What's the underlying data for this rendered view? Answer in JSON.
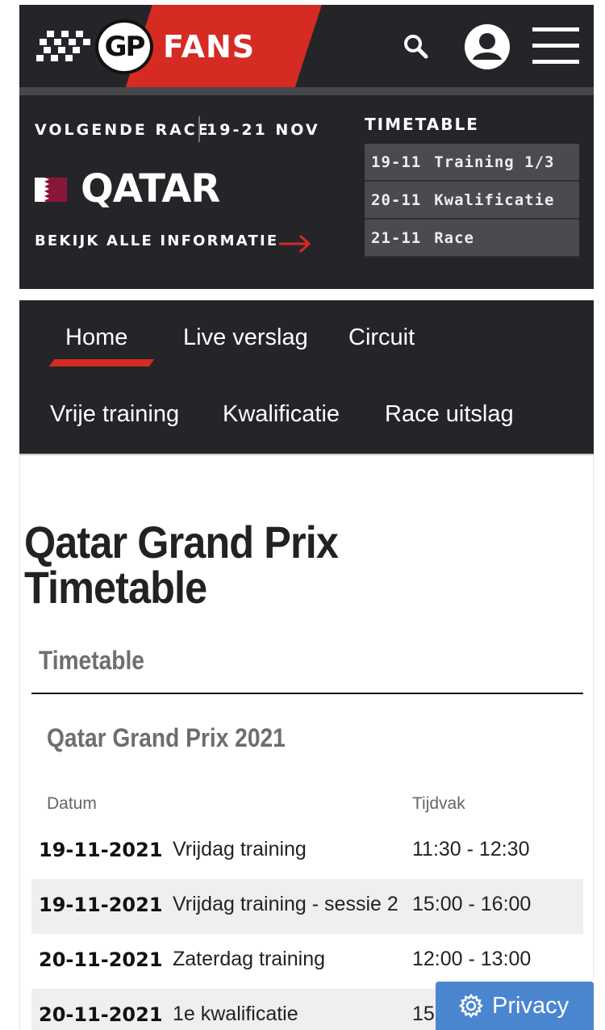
{
  "brand": {
    "logo_gp": "GP",
    "logo_fans": "FANS",
    "brand_red": "#d52b23"
  },
  "header": {
    "icons": [
      "search-icon",
      "user-icon",
      "menu-icon"
    ]
  },
  "next_race": {
    "label": "VOLGENDE RACE",
    "dates": "19-21 NOV",
    "country": "QATAR",
    "info_link": "BEKIJK ALLE INFORMATIE",
    "timetable_title": "TIMETABLE",
    "timetable": [
      {
        "date": "19-11",
        "session": "Training 1/3"
      },
      {
        "date": "20-11",
        "session": "Kwalificatie"
      },
      {
        "date": "21-11",
        "session": "Race"
      }
    ]
  },
  "nav": {
    "items": [
      {
        "label": "Home",
        "active": true
      },
      {
        "label": "Live verslag"
      },
      {
        "label": "Circuit"
      },
      {
        "label": "Vrije training"
      },
      {
        "label": "Kwalificatie"
      },
      {
        "label": "Race uitslag"
      }
    ]
  },
  "main": {
    "title_line1": "Qatar Grand Prix",
    "title_line2": "Timetable",
    "section_title": "Timetable",
    "season_title": "Qatar Grand Prix 2021",
    "columns": [
      "Datum",
      "Tijdvak"
    ],
    "rows": [
      {
        "date": "19-11-2021",
        "session": "Vrijdag training",
        "time": "11:30 - 12:30"
      },
      {
        "date": "19-11-2021",
        "session": "Vrijdag training - sessie 2",
        "time": "15:00 - 16:00"
      },
      {
        "date": "20-11-2021",
        "session": "Zaterdag training",
        "time": "12:00 - 13:00"
      },
      {
        "date": "20-11-2021",
        "session": "1e kwalificatie",
        "time": "15"
      }
    ]
  },
  "privacy": {
    "label": "Privacy"
  }
}
